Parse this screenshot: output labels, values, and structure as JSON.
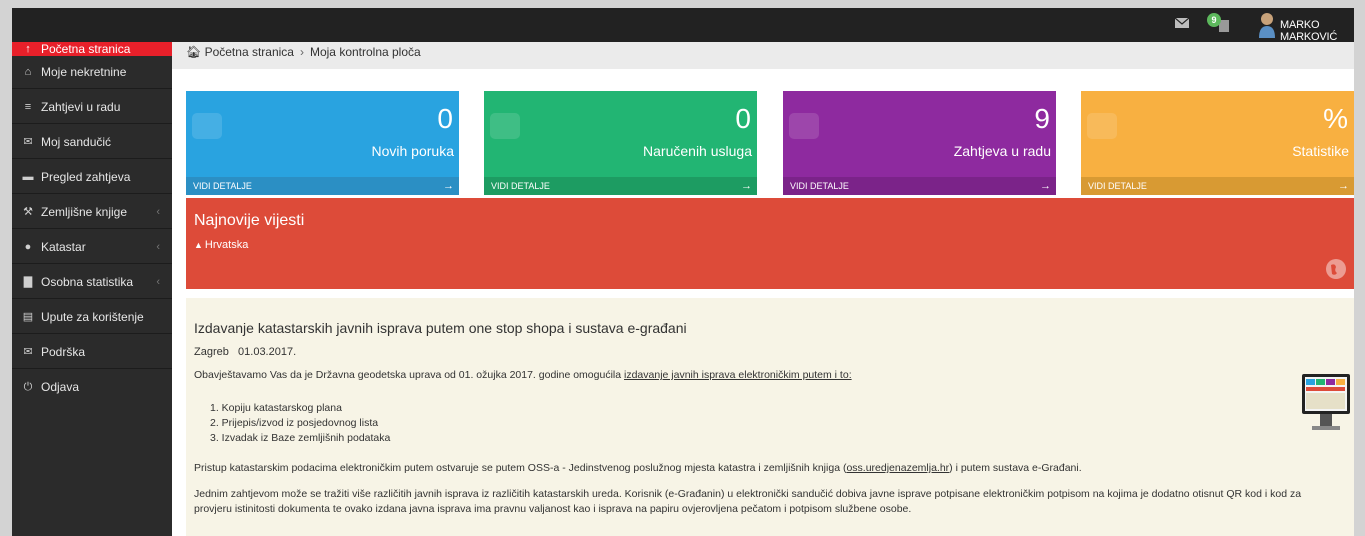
{
  "topbar": {
    "notif_count": "9",
    "username": "MARKO MARKOVIĆ",
    "icons": [
      "mail-icon",
      "notification-icon",
      "user-avatar-icon"
    ]
  },
  "sidebar": {
    "items": [
      {
        "label": "Početna stranica",
        "icon": "arrow-up-icon",
        "active": true
      },
      {
        "label": "Moje nekretnine",
        "icon": "home-icon"
      },
      {
        "label": "Zahtjevi u radu",
        "icon": "list-icon"
      },
      {
        "label": "Moj sandučić",
        "icon": "envelope-icon"
      },
      {
        "label": "Pregled zahtjeva",
        "icon": "folder-icon"
      },
      {
        "label": "Zemljišne knjige",
        "icon": "gavel-icon",
        "arrow": "‹"
      },
      {
        "label": "Katastar",
        "icon": "globe-icon",
        "arrow": "‹"
      },
      {
        "label": "Osobna statistika",
        "icon": "bar-chart-icon",
        "arrow": "‹"
      },
      {
        "label": "Upute za korištenje",
        "icon": "document-icon"
      },
      {
        "label": "Podrška",
        "icon": "envelope-icon"
      },
      {
        "label": "Odjava",
        "icon": "power-icon"
      }
    ]
  },
  "breadcrumb": {
    "home": "Početna stranica",
    "separator": "›",
    "current": "Moja kontrolna ploča"
  },
  "tiles": [
    {
      "value": "0",
      "label": "Novih poruka",
      "footer": "VIDI DETALJE",
      "color": "#29a3e0",
      "footer_color": "#2b8fc4",
      "icon": "comments-icon"
    },
    {
      "value": "0",
      "label": "Naručenih usluga",
      "footer": "VIDI DETALJE",
      "color": "#22b573",
      "footer_color": "#1d9c62",
      "icon": "cart-icon"
    },
    {
      "value": "9",
      "label": "Zahtjeva u radu",
      "footer": "VIDI DETALJE",
      "color": "#8e2a9f",
      "footer_color": "#7b2389",
      "icon": "globe-icon"
    },
    {
      "value": "%",
      "label": "Statistike",
      "footer": "VIDI DETALJE",
      "color": "#f8b041",
      "footer_color": "#d89a33",
      "icon": "bar-chart-icon"
    }
  ],
  "news": {
    "title": "Najnovije vijesti",
    "tag": "Hrvatska",
    "color": "#dd4b39"
  },
  "article": {
    "title": "Izdavanje katastarskih javnih isprava putem one stop shopa i sustava e-građani",
    "place": "Zagreb",
    "date": "01.03.2017.",
    "p1_text": "Obavještavamo Vas da je Državna geodetska uprava od 01. ožujka 2017. godine omogućila ",
    "p1_link": "izdavanje javnih isprava elektroničkim putem i to:",
    "list": [
      "1. Kopiju katastarskog plana",
      "2. Prijepis/izvod iz posjedovnog lista",
      "3. Izvadak iz Baze zemljišnih podataka"
    ],
    "p2_before": "Pristup katastarskim podacima elektroničkim putem ostvaruje se putem OSS-a - Jedinstvenog poslužnog mjesta katastra i zemljišnih knjiga (",
    "p2_link": "oss.uredjenazemlja.hr",
    "p2_after": ") i putem sustava e-Građani.",
    "p3": "Jednim zahtjevom može se tražiti više različitih javnih isprava iz različitih katastarskih ureda. Korisnik (e-Građanin) u elektronički sandučić dobiva javne isprave potpisane elektroničkim potpisom na kojima je dodatno otisnut QR kod i kod za provjeru istinitosti dokumenta te ovako izdana javna isprava ima pravnu valjanost kao i isprava na papiru ovjerovljena pečatom i potpisom službene osobe."
  }
}
